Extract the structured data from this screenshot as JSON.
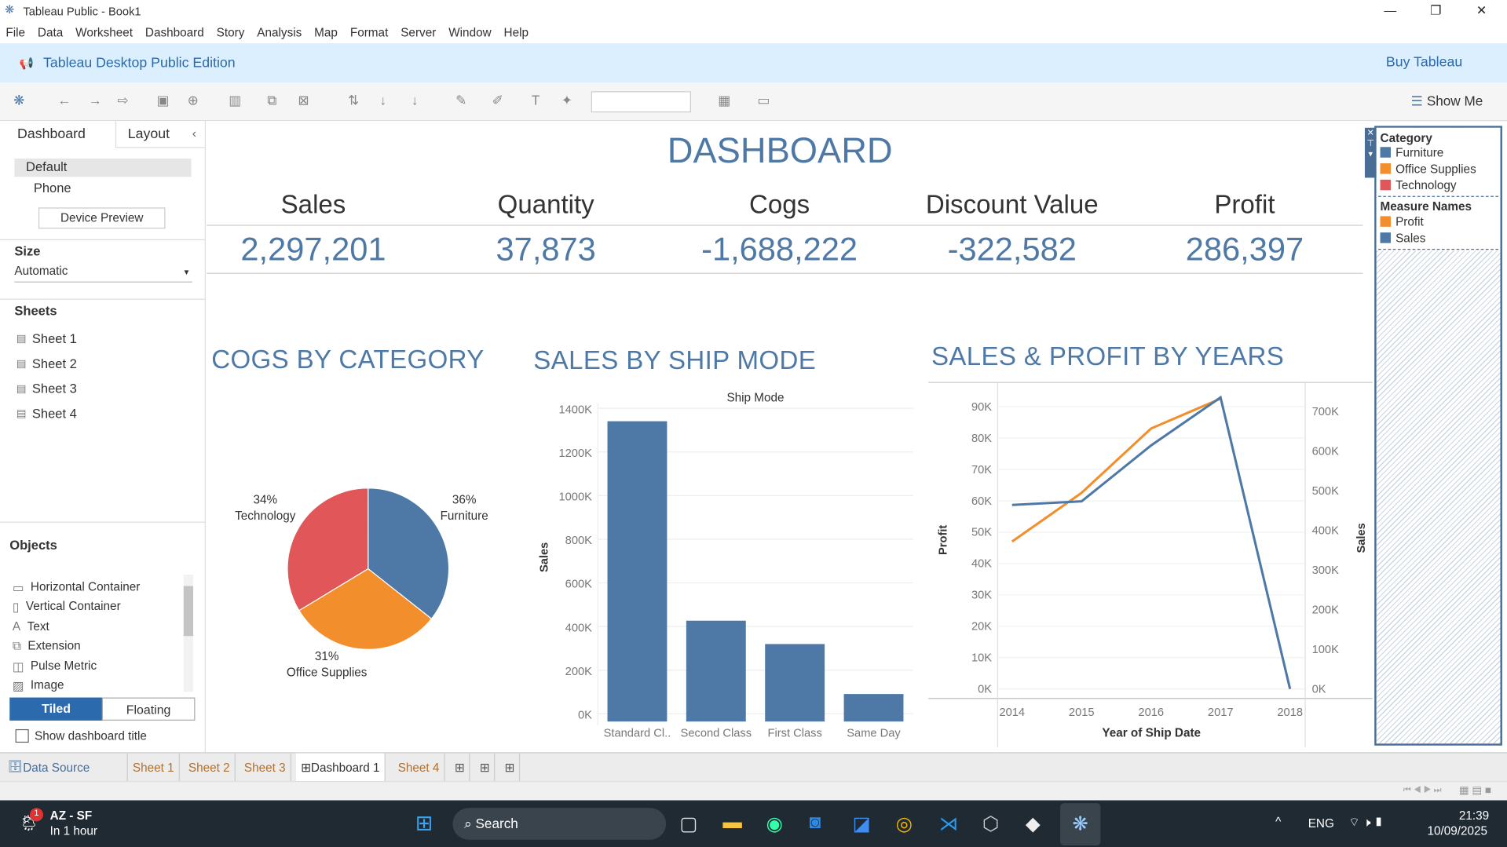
{
  "window": {
    "title": "Tableau Public - Book1",
    "minimize": "—",
    "maximize": "❐",
    "close": "✕"
  },
  "menu": [
    "File",
    "Data",
    "Worksheet",
    "Dashboard",
    "Story",
    "Analysis",
    "Map",
    "Format",
    "Server",
    "Window",
    "Help"
  ],
  "banner": {
    "edition": "Tableau Desktop Public Edition",
    "buy": "Buy Tableau"
  },
  "toolbar": {
    "show_me": "Show Me"
  },
  "left": {
    "tab_dashboard": "Dashboard",
    "tab_layout": "Layout",
    "collapse": "‹",
    "default": "Default",
    "phone": "Phone",
    "device_preview": "Device Preview",
    "size_label": "Size",
    "size_value": "Automatic",
    "sheets_label": "Sheets",
    "sheets": [
      "Sheet 1",
      "Sheet 2",
      "Sheet 3",
      "Sheet 4"
    ],
    "objects_label": "Objects",
    "objects": [
      "Horizontal Container",
      "Vertical Container",
      "Text",
      "Extension",
      "Pulse Metric",
      "Image"
    ],
    "tiled": "Tiled",
    "floating": "Floating",
    "show_title": "Show dashboard title"
  },
  "dashboard": {
    "title": "DASHBOARD",
    "kpis": [
      {
        "label": "Sales",
        "value": "2,297,201"
      },
      {
        "label": "Quantity",
        "value": "37,873"
      },
      {
        "label": "Cogs",
        "value": "-1,688,222"
      },
      {
        "label": "Discount Value",
        "value": "-322,582"
      },
      {
        "label": "Profit",
        "value": "286,397"
      }
    ]
  },
  "legend": {
    "category_title": "Category",
    "categories": [
      {
        "name": "Furniture",
        "color": "#4e79a7"
      },
      {
        "name": "Office Supplies",
        "color": "#f28e2b"
      },
      {
        "name": "Technology",
        "color": "#e15759"
      }
    ],
    "measure_title": "Measure Names",
    "measures": [
      {
        "name": "Profit",
        "color": "#f28e2b"
      },
      {
        "name": "Sales",
        "color": "#4e79a7"
      }
    ]
  },
  "chart_data": [
    {
      "type": "pie",
      "title": "COGS BY CATEGORY",
      "slices": [
        {
          "label": "Furniture",
          "percent": 36,
          "pct_label": "36%",
          "color": "#4e79a7"
        },
        {
          "label": "Office Supplies",
          "percent": 31,
          "pct_label": "31%",
          "color": "#f28e2b"
        },
        {
          "label": "Technology",
          "percent": 34,
          "pct_label": "34%",
          "color": "#e15759"
        }
      ]
    },
    {
      "type": "bar",
      "title": "SALES BY SHIP MODE",
      "header": "Ship Mode",
      "ylabel": "Sales",
      "categories": [
        "Standard Cl..",
        "Second Class",
        "First Class",
        "Same Day"
      ],
      "values": [
        1376000,
        462000,
        355000,
        126000
      ],
      "yticks": [
        "0K",
        "200K",
        "400K",
        "600K",
        "800K",
        "1000K",
        "1200K",
        "1400K"
      ],
      "ylim": [
        0,
        1440000
      ],
      "color": "#4e79a7",
      "grid": true
    },
    {
      "type": "line",
      "title": "SALES & PROFIT BY YEARS",
      "xlabel": "Year of Ship Date",
      "ylabel_left": "Profit",
      "ylabel_right": "Sales",
      "x": [
        "2014",
        "2015",
        "2016",
        "2017",
        "2018"
      ],
      "series": [
        {
          "name": "Profit",
          "axis": "left",
          "color": "#f28e2b",
          "values": [
            47000,
            62500,
            83000,
            92500,
            null
          ]
        },
        {
          "name": "Sales",
          "axis": "right",
          "color": "#4e79a7",
          "values": [
            464000,
            473000,
            614000,
            735000,
            0
          ]
        }
      ],
      "yticks_left": [
        "0K",
        "10K",
        "20K",
        "30K",
        "40K",
        "50K",
        "60K",
        "70K",
        "80K",
        "90K"
      ],
      "yticks_right": [
        "0K",
        "100K",
        "200K",
        "300K",
        "400K",
        "500K",
        "600K",
        "700K"
      ],
      "ylim_left": [
        -3000,
        97700
      ],
      "ylim_right": [
        -24000,
        773000
      ],
      "grid": true
    }
  ],
  "tabs": {
    "data_source": "Data Source",
    "items": [
      "Sheet 1",
      "Sheet 2",
      "Sheet 3",
      "Dashboard 1",
      "Sheet 4"
    ],
    "active": "Dashboard 1"
  },
  "taskbar": {
    "weather_title": "AZ - SF",
    "weather_sub": "In 1 hour",
    "badge": "1",
    "search": "Search",
    "lang": "ENG",
    "time": "21:39",
    "date": "10/09/2025"
  }
}
